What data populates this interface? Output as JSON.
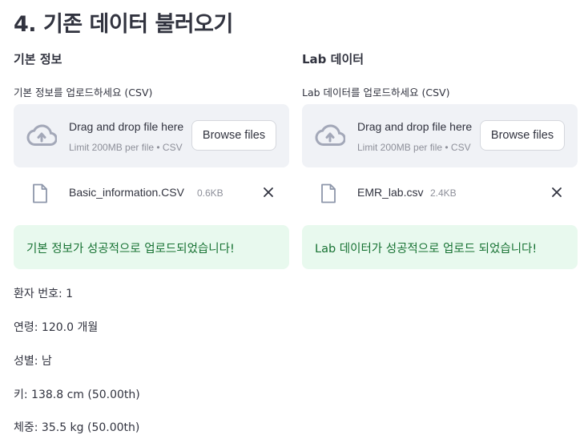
{
  "page": {
    "title": "4. 기존 데이터 불러오기"
  },
  "left": {
    "section_title": "기본 정보",
    "upload_label": "기본 정보를 업로드하세요 (CSV)",
    "dropzone": {
      "main_text": "Drag and drop file here",
      "sub_text": "Limit 200MB per file • CSV",
      "browse_label": "Browse files"
    },
    "file": {
      "name": "Basic_information.CSV",
      "size": "0.6KB"
    },
    "success_message": "기본 정보가 성공적으로 업로드되었습니다!"
  },
  "right": {
    "section_title": "Lab 데이터",
    "upload_label": "Lab 데이터를 업로드하세요 (CSV)",
    "dropzone": {
      "main_text": "Drag and drop file here",
      "sub_text": "Limit 200MB per file • CSV",
      "browse_label": "Browse files"
    },
    "file": {
      "name": "EMR_lab.csv",
      "size": "2.4KB"
    },
    "success_message": "Lab 데이터가 성공적으로 업로드 되었습니다!"
  },
  "patient_info": [
    "환자 번호: 1",
    "연령: 120.0 개월",
    "성별: 남",
    "키: 138.8 cm (50.00th)",
    "체중: 35.5 kg (50.00th)"
  ],
  "icons": {
    "upload": "cloud-upload-icon",
    "file": "file-icon",
    "close": "close-icon"
  },
  "colors": {
    "dropzone_bg": "#f0f2f6",
    "success_bg": "#e8f9ee",
    "success_text": "#177233",
    "icon_gray": "#a3a8b8"
  }
}
